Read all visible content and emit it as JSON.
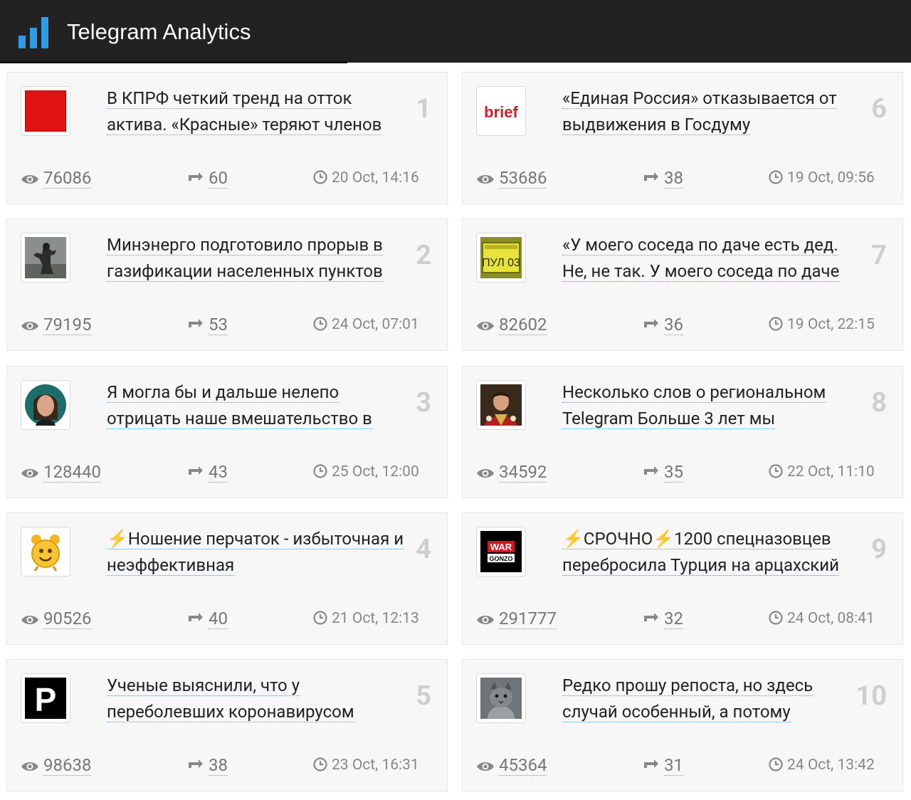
{
  "app": {
    "title": "Telegram Analytics",
    "icon": "bar-chart-logo-icon",
    "accent": "#2d9be5"
  },
  "posts": [
    {
      "rank": "1",
      "title": "В КПРФ четкий тренд на отток актива. «Красные» теряют членов",
      "views": "76086",
      "reposts": "60",
      "date": "20 Oct, 14:16",
      "avatar": "red-square-avatar"
    },
    {
      "rank": "2",
      "title": "Минэнерго подготовило прорыв в газификации населенных пунктов",
      "views": "79195",
      "reposts": "53",
      "date": "24 Oct, 07:01",
      "avatar": "statue-avatar"
    },
    {
      "rank": "3",
      "title": "Я могла бы и дальше нелепо отрицать наше вмешательство в",
      "views": "128440",
      "reposts": "43",
      "date": "25 Oct, 12:00",
      "avatar": "woman-portrait-avatar"
    },
    {
      "rank": "4",
      "title": "⚡️Ношение перчаток - избыточная и неэффективная",
      "views": "90526",
      "reposts": "40",
      "date": "21 Oct, 12:13",
      "avatar": "alarm-clock-avatar"
    },
    {
      "rank": "5",
      "title": "Ученые выяснили, что у переболевших коронавирусом",
      "views": "98638",
      "reposts": "38",
      "date": "23 Oct, 16:31",
      "avatar": "letter-p-avatar",
      "avatar_text": "P"
    },
    {
      "rank": "6",
      "title": "«Единая Россия» отказывается от выдвижения в Госдуму",
      "views": "53686",
      "reposts": "38",
      "date": "19 Oct, 09:56",
      "avatar": "brief-logo-avatar",
      "avatar_text": "brief"
    },
    {
      "rank": "7",
      "title": "«У моего соседа по даче есть дед. Не, не так. У моего соседа по даче",
      "views": "82602",
      "reposts": "36",
      "date": "19 Oct, 22:15",
      "avatar": "pul-03-sign-avatar",
      "avatar_text": "ПУЛ 03"
    },
    {
      "rank": "8",
      "title": "Несколько слов о региональном Telegram Больше 3 лет мы",
      "views": "34592",
      "reposts": "35",
      "date": "22 Oct, 11:10",
      "avatar": "man-portrait-avatar"
    },
    {
      "rank": "9",
      "title": "⚡️СРОЧНО⚡️1200 спецназовцев перебросила Турция на арцахский",
      "views": "291777",
      "reposts": "32",
      "date": "24 Oct, 08:41",
      "avatar": "war-gonzo-logo-avatar",
      "avatar_text": "WAR",
      "avatar_subtext": "GONZO"
    },
    {
      "rank": "10",
      "title": "Редко прошу репоста, но здесь случай особенный, а потому",
      "views": "45364",
      "reposts": "31",
      "date": "24 Oct, 13:42",
      "avatar": "cat-photo-avatar"
    }
  ]
}
